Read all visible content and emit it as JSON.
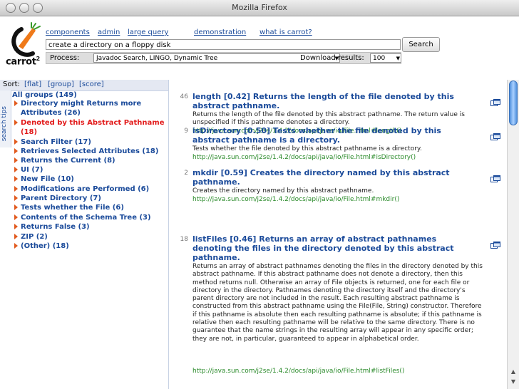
{
  "window": {
    "title": "Mozilla Firefox"
  },
  "logo": {
    "text": "carrot",
    "sup": "2"
  },
  "nav": [
    {
      "label": "components"
    },
    {
      "label": "admin"
    },
    {
      "label": "large query"
    },
    {
      "label": "demonstration"
    },
    {
      "label": "what is carrot?"
    }
  ],
  "search": {
    "query": "create a directory on a floppy disk",
    "button": "Search"
  },
  "process": {
    "label": "Process:",
    "value": "Javadoc Search, LINGO, Dynamic Tree"
  },
  "download": {
    "label": "Download results:",
    "value": "100"
  },
  "sort": {
    "label": "Sort:",
    "options": [
      "[flat]",
      "[group]",
      "[score]"
    ]
  },
  "sidebar_tab": "search tips",
  "groups": {
    "all": "All groups (149)",
    "items": [
      "Directory might Returns more Attributes (26)",
      "Denoted by this Abstract Pathname (18)",
      "Search Filter (17)",
      "Retrieves Selected Attributes (18)",
      "Returns the Current (8)",
      "UI (7)",
      "New File (10)",
      "Modifications are Performed (6)",
      "Parent Directory (7)",
      "Tests whether the File (6)",
      "Contents of the Schema Tree (3)",
      "Returns False (3)",
      "ZIP (2)",
      "(Other) (18)"
    ],
    "selected_index": 1
  },
  "results": [
    {
      "num": "46",
      "title": "length [0.42] Returns the length of the file denoted by this abstract pathname.",
      "snippet": "Returns the length of the file denoted by this abstract pathname. The return value is unspecified if this pathname denotes a directory.",
      "url": "http://java.sun.com/j2se/1.4.2/docs/api/java/io/File.html#length()"
    },
    {
      "num": "9",
      "title": "isDirectory [0.50] Tests whether the file denoted by this abstract pathname is a directory.",
      "snippet": "Tests whether the file denoted by this abstract pathname is a directory.",
      "url": "http://java.sun.com/j2se/1.4.2/docs/api/java/io/File.html#isDirectory()"
    },
    {
      "num": "2",
      "title": "mkdir [0.59] Creates the directory named by this abstract pathname.",
      "snippet": "Creates the directory named by this abstract pathname.",
      "url": "http://java.sun.com/j2se/1.4.2/docs/api/java/io/File.html#mkdir()"
    },
    {
      "num": "18",
      "title": "listFiles [0.46] Returns an array of abstract pathnames denoting the files in the directory denoted by this abstract pathname.",
      "snippet": "Returns an array of abstract pathnames denoting the files in the directory denoted by this abstract pathname. If this abstract pathname does not denote a directory, then this method returns null. Otherwise an array of File objects is returned, one for each file or directory in the directory. Pathnames denoting the directory itself and the directory's parent directory are not included in the result. Each resulting abstract pathname is constructed from this abstract pathname using the File(File, String) constructor. Therefore if this pathname is absolute then each resulting pathname is absolute; if this pathname is relative then each resulting pathname will be relative to the same directory. There is no guarantee that the name strings in the resulting array will appear in any specific order; they are not, in particular, guaranteed to appear in alphabetical order.",
      "url": "http://java.sun.com/j2se/1.4.2/docs/api/java/io/File.html#listFiles()"
    }
  ],
  "colors": {
    "link": "#1a4a9a",
    "selected_group": "#e21a1a",
    "url": "#2a8a2a",
    "triangle": "#e25a1e"
  },
  "icons": [
    "close-traffic-icon",
    "minimize-traffic-icon",
    "zoom-traffic-icon",
    "carrot-logo-icon",
    "dropdown-arrow-icon",
    "expand-triangle-icon",
    "open-in-window-icon",
    "scroll-up-arrow-icon",
    "scroll-down-arrow-icon"
  ]
}
